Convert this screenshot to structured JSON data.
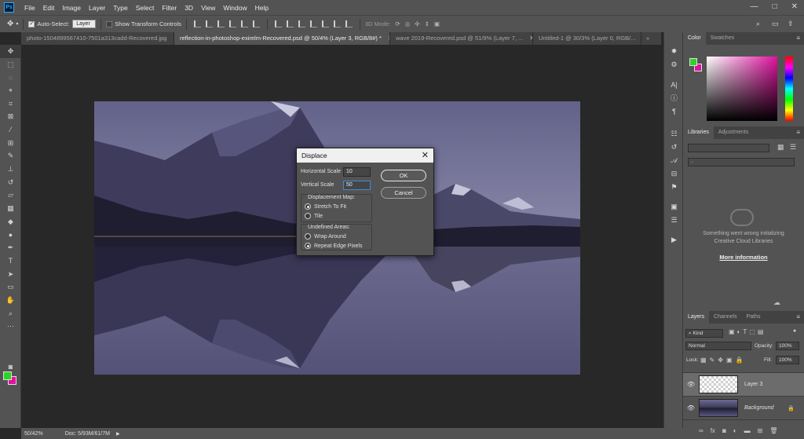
{
  "app": {
    "logo": "Ps"
  },
  "menu": [
    "File",
    "Edit",
    "Image",
    "Layer",
    "Type",
    "Select",
    "Filter",
    "3D",
    "View",
    "Window",
    "Help"
  ],
  "window_controls": {
    "minimize": "—",
    "maximize": "□",
    "close": "✕"
  },
  "options_bar": {
    "auto_select_label": "Auto-Select:",
    "auto_select_value": "Layer",
    "show_transform_label": "Show Transform Controls",
    "mode_3d_label": "3D Mode:"
  },
  "tabs": [
    {
      "label": "photo-1504899567410-7501a313cadd-Recovered.jpg"
    },
    {
      "label": "reflection-in-photoshop-exirelm-Recovered.psd @ 50/4% (Layer 3, RGB/8#) *"
    },
    {
      "label": "wave 2019-Recovered.psd @ 51/9% (Layer 7, ..."
    },
    {
      "label": "Untitled-1 @ 30/3% (Layer 0, RGB/..."
    }
  ],
  "tab_overflow": "»",
  "status": {
    "zoom": "50/42%",
    "doc": "Doc: 5/93M/61/7M"
  },
  "dialog": {
    "title": "Displace",
    "horizontal_scale_label": "Horizontal Scale",
    "horizontal_scale_value": "10",
    "vertical_scale_label": "Vertical Scale",
    "vertical_scale_value": "50",
    "ok": "OK",
    "cancel": "Cancel",
    "displacement_map_label": "Displacement Map:",
    "stretch_to_fit": "Stretch To Fit",
    "tile": "Tile",
    "undefined_areas_label": "Undefined Areas:",
    "wrap_around": "Wrap Around",
    "repeat_edge_pixels": "Repeat Edge Pixels"
  },
  "color_panel": {
    "tabs": [
      "Color",
      "Swatches"
    ]
  },
  "libraries_panel": {
    "tabs": [
      "Libraries",
      "Adjustments"
    ],
    "error_line1": "Something went wrong initializing",
    "error_line2": "Creative Cloud Libraries",
    "more_info": "More information"
  },
  "layers_panel": {
    "tabs": [
      "Layers",
      "Channels",
      "Paths"
    ],
    "filter_kind": "Kind",
    "blend_mode": "Normal",
    "opacity_label": "Opacity:",
    "opacity_value": "100%",
    "lock_label": "Lock:",
    "fill_label": "Fill:",
    "fill_value": "100%",
    "layers": [
      {
        "name": "Layer 3",
        "selected": true
      },
      {
        "name": "Background",
        "selected": false
      }
    ],
    "footer_icons": [
      "link-icon",
      "fx-icon",
      "mask-icon",
      "adjustment-icon",
      "group-icon",
      "new-layer-icon",
      "trash-icon"
    ]
  },
  "colors": {
    "foreground": "#2ad324",
    "background": "#e0119f",
    "accent": "#31a8ff"
  }
}
